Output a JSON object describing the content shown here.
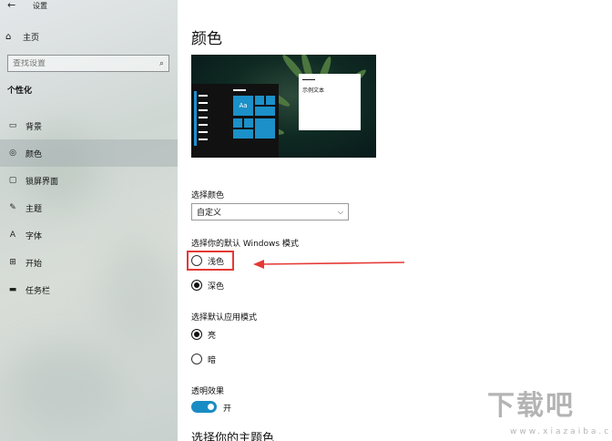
{
  "window": {
    "title": "设置"
  },
  "sidebar": {
    "home": "主页",
    "search_placeholder": "查找设置",
    "section": "个性化",
    "items": [
      {
        "label": "背景",
        "icon": "image-icon"
      },
      {
        "label": "颜色",
        "icon": "palette-icon",
        "selected": true
      },
      {
        "label": "锁屏界面",
        "icon": "lock-screen-icon"
      },
      {
        "label": "主题",
        "icon": "brush-icon"
      },
      {
        "label": "字体",
        "icon": "font-icon"
      },
      {
        "label": "开始",
        "icon": "start-icon"
      },
      {
        "label": "任务栏",
        "icon": "taskbar-icon"
      }
    ]
  },
  "main": {
    "title": "颜色",
    "preview": {
      "tile_label": "Aa",
      "sample_text": "示例文本"
    },
    "choose_color": {
      "label": "选择颜色",
      "selected": "自定义"
    },
    "windows_mode": {
      "label": "选择你的默认 Windows 模式",
      "options": [
        {
          "label": "浅色",
          "checked": false
        },
        {
          "label": "深色",
          "checked": true
        }
      ]
    },
    "app_mode": {
      "label": "选择默认应用模式",
      "options": [
        {
          "label": "亮",
          "checked": true
        },
        {
          "label": "暗",
          "checked": false
        }
      ]
    },
    "transparency": {
      "label": "透明效果",
      "state_label": "开",
      "on": true
    },
    "next_heading": "选择你的主题色"
  },
  "colors": {
    "accent": "#1a8cc4",
    "annotation": "#e53935"
  },
  "watermark": {
    "main": "下载吧",
    "sub": "www.xiazaiba.com"
  }
}
